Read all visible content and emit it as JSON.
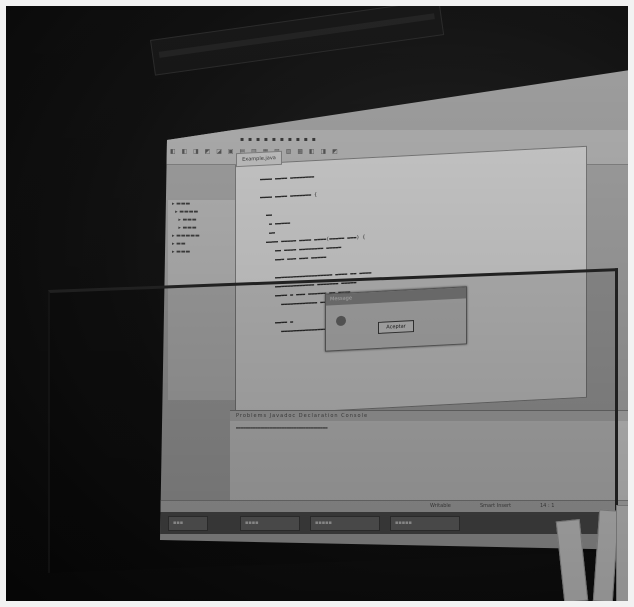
{
  "scene": {
    "description_tags": [
      "projector-screen",
      "ide-window",
      "dialog",
      "glass-partition",
      "chairs"
    ]
  },
  "ide": {
    "tab_label": "Example.java",
    "dialog": {
      "title": "Message",
      "ok_button": "Aceptar"
    },
    "statusbar": {
      "writable": "Writable",
      "insert_mode": "Smart Insert",
      "position": "14 : 1"
    },
    "bottom_tabs": "Problems  Javadoc  Declaration  Console"
  },
  "colors": {
    "background": "#0d0d0d",
    "screen": "#bdbdbd",
    "editor": "#efefef"
  }
}
